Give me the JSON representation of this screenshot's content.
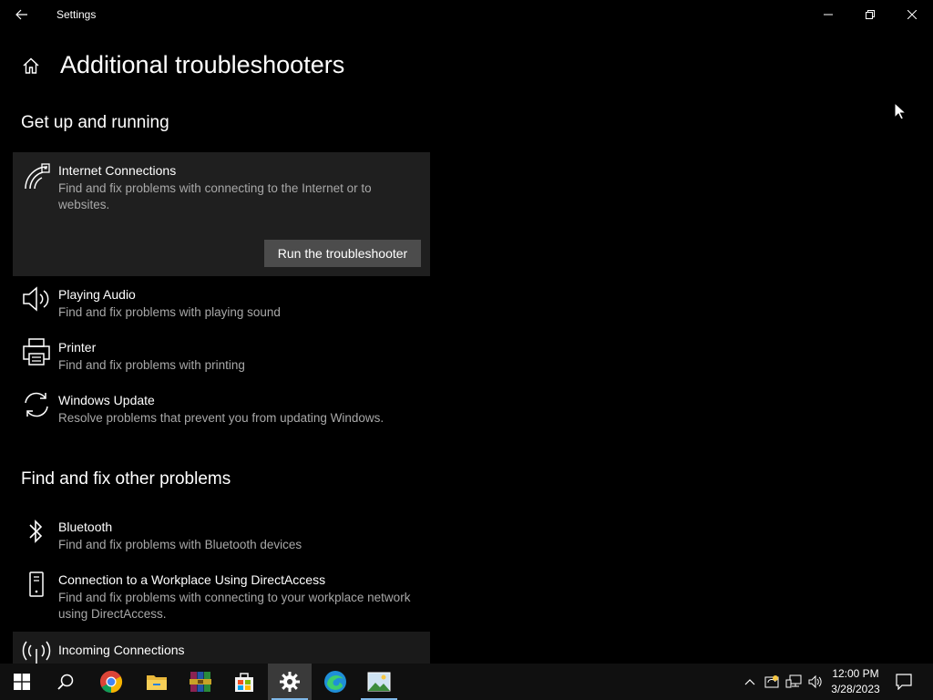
{
  "window": {
    "title": "Settings"
  },
  "page": {
    "title": "Additional troubleshooters"
  },
  "sections": {
    "get_up": {
      "heading": "Get up and running",
      "items": [
        {
          "name": "Internet Connections",
          "desc": "Find and fix problems with connecting to the Internet or to websites.",
          "icon": "wifi-icon"
        },
        {
          "name": "Playing Audio",
          "desc": "Find and fix problems with playing sound",
          "icon": "speaker-icon"
        },
        {
          "name": "Printer",
          "desc": "Find and fix problems with printing",
          "icon": "printer-icon"
        },
        {
          "name": "Windows Update",
          "desc": "Resolve problems that prevent you from updating Windows.",
          "icon": "refresh-icon"
        }
      ],
      "run_button": "Run the troubleshooter"
    },
    "other": {
      "heading": "Find and fix other problems",
      "items": [
        {
          "name": "Bluetooth",
          "desc": "Find and fix problems with Bluetooth devices",
          "icon": "bluetooth-icon"
        },
        {
          "name": "Connection to a Workplace Using DirectAccess",
          "desc": "Find and fix problems with connecting to your workplace network using DirectAccess.",
          "icon": "phone-icon"
        },
        {
          "name": "Incoming Connections",
          "desc": "",
          "icon": "antenna-icon"
        }
      ]
    }
  },
  "taskbar": {
    "apps": [
      "Start",
      "Search",
      "Google Chrome",
      "File Explorer",
      "WinRAR",
      "Store",
      "Settings",
      "Microsoft Edge",
      "Photos"
    ],
    "clock": {
      "time": "12:00 PM",
      "date": "3/28/2023"
    }
  },
  "colors": {
    "background": "#000000",
    "panel": "#1f1f1f",
    "button": "#4c4c4c",
    "secondary_text": "#a8a8a8"
  }
}
